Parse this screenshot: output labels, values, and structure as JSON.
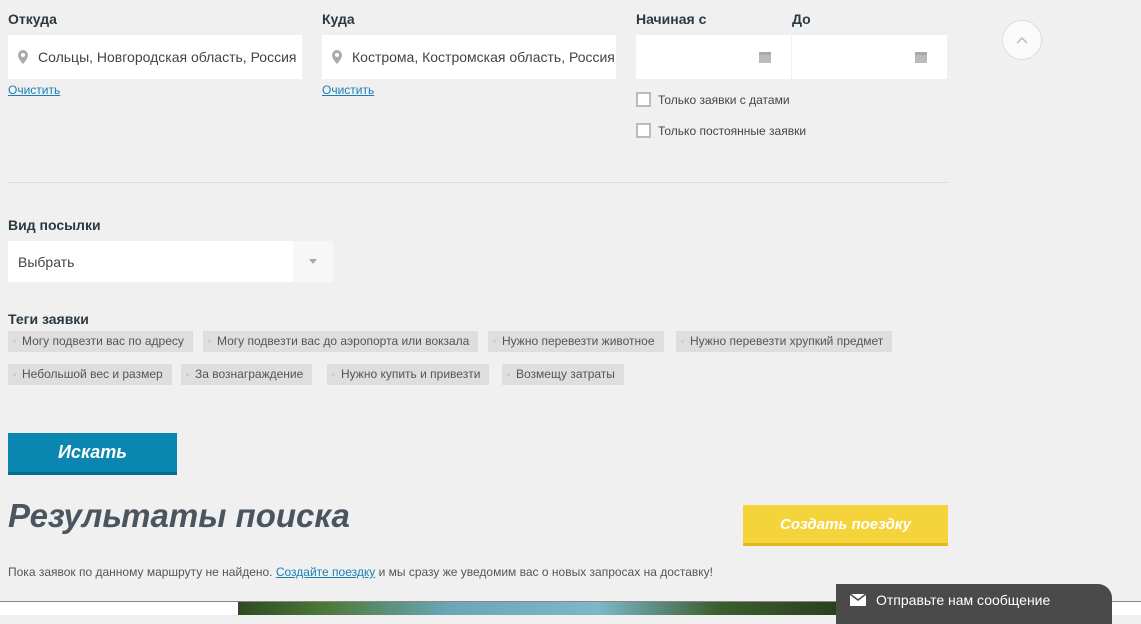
{
  "from": {
    "label": "Откуда",
    "value": "Сольцы, Новгородская область, Россия",
    "clear": "Очистить"
  },
  "to": {
    "label": "Куда",
    "value": "Кострома, Костромская область, Россия",
    "clear": "Очистить"
  },
  "date_from": {
    "label": "Начиная с",
    "value": ""
  },
  "date_to": {
    "label": "До",
    "value": ""
  },
  "checkboxes": [
    {
      "label": "Только заявки с датами",
      "checked": false
    },
    {
      "label": "Только постоянные заявки",
      "checked": false
    }
  ],
  "parcel": {
    "label": "Вид посылки",
    "value": "Выбрать"
  },
  "tags": {
    "label": "Теги заявки",
    "items": [
      "Могу подвезти вас по адресу",
      "Могу подвезти вас до аэропорта или вокзала",
      "Нужно перевезти животное",
      "Нужно перевезти хрупкий предмет",
      "Небольшой вес и размер",
      "За вознаграждение",
      "Нужно купить и привезти",
      "Возмещу затраты"
    ]
  },
  "search_button": "Искать",
  "results": {
    "title": "Результаты поиска",
    "create_button": "Создать поездку",
    "message_before": "Пока заявок по данному маршруту не найдено. ",
    "message_link": "Создайте поездку",
    "message_after": " и мы сразу же уведомим вас о новых запросах на доставку!"
  },
  "feedback": {
    "label": "Отправьте нам сообщение"
  },
  "colors": {
    "primary": "#0a86b0",
    "accent": "#f5d33a",
    "bg": "#f0f0f0"
  }
}
